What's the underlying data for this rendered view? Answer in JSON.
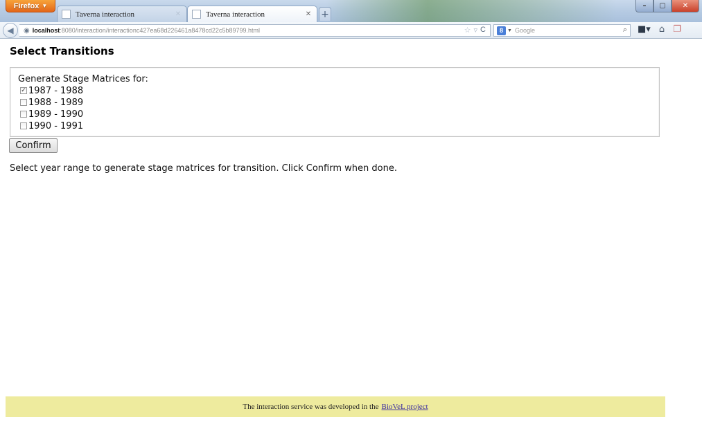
{
  "browser": {
    "menu_button": "Firefox",
    "tabs": [
      {
        "label": "Taverna interaction",
        "active": false
      },
      {
        "label": "Taverna interaction",
        "active": true
      }
    ],
    "new_tab": "+",
    "url_host": "localhost",
    "url_rest": ":8080/interaction/interactionc427ea68d226461a8478cd22c5b89799.html",
    "search_placeholder": "Google",
    "search_engine_letter": "8"
  },
  "page": {
    "title": "Select Transitions",
    "group_label": "Generate Stage Matrices for:",
    "options": [
      {
        "label": "1987 - 1988",
        "checked": true
      },
      {
        "label": "1988 - 1989",
        "checked": false
      },
      {
        "label": "1989 - 1990",
        "checked": false
      },
      {
        "label": "1990 - 1991",
        "checked": false
      }
    ],
    "confirm_label": "Confirm",
    "instructions": "Select year range to generate stage matrices for transition. Click Confirm when done."
  },
  "footer": {
    "text": "The interaction service was developed in the",
    "link_text": "BioVeL project"
  },
  "colors": {
    "footer_bg": "#eeeb9e",
    "firefox_orange": "#e3661a",
    "link": "#3a2ca0"
  }
}
